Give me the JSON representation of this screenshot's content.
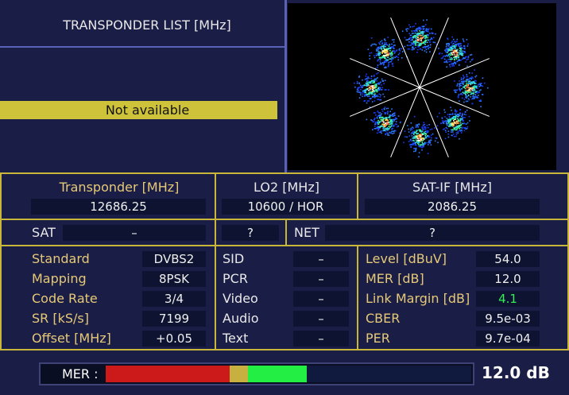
{
  "header": {
    "title": "TRANSPONDER LIST [MHz]",
    "status": "Not available"
  },
  "constellation": {
    "clusters": 8,
    "modulation": "8PSK"
  },
  "transponder_row": {
    "transponder": {
      "label": "Transponder [MHz]",
      "value": "12686.25"
    },
    "lo2": {
      "label": "LO2 [MHz]",
      "value": "10600 / HOR"
    },
    "satif": {
      "label": "SAT-IF [MHz]",
      "value": "2086.25"
    }
  },
  "sat_row": {
    "sat_label": "SAT",
    "sat_value": "–",
    "mid_value": "?",
    "net_label": "NET",
    "net_value": "?"
  },
  "left_params": [
    {
      "label": "Standard",
      "value": "DVBS2"
    },
    {
      "label": "Mapping",
      "value": "8PSK"
    },
    {
      "label": "Code Rate",
      "value": "3/4"
    },
    {
      "label": "SR [kS/s]",
      "value": "7199"
    },
    {
      "label": "Offset [MHz]",
      "value": "+0.05"
    }
  ],
  "mid_params": [
    {
      "label": "SID",
      "value": "–"
    },
    {
      "label": "PCR",
      "value": "–"
    },
    {
      "label": "Video",
      "value": "–"
    },
    {
      "label": "Audio",
      "value": "–"
    },
    {
      "label": "Text",
      "value": "–"
    }
  ],
  "right_params": [
    {
      "label": "Level [dBuV]",
      "value": "54.0"
    },
    {
      "label": "MER [dB]",
      "value": "12.0"
    },
    {
      "label": "Link Margin [dB]",
      "value": "4.1",
      "highlight": true
    },
    {
      "label": "CBER",
      "value": "9.5e-03"
    },
    {
      "label": "PER",
      "value": "9.7e-04"
    }
  ],
  "mer_bar": {
    "label": "MER :",
    "value": "12.0 dB",
    "segments": [
      {
        "color": "#cc1a1a",
        "fraction": 0.34
      },
      {
        "color": "#c8b040",
        "fraction": 0.05
      },
      {
        "color": "#22ee44",
        "fraction": 0.16
      }
    ]
  },
  "colors": {
    "label": "#e6c977",
    "accent_yellow": "#c9b73a",
    "panel": "#1a1d46",
    "good_green": "#33ee55"
  }
}
